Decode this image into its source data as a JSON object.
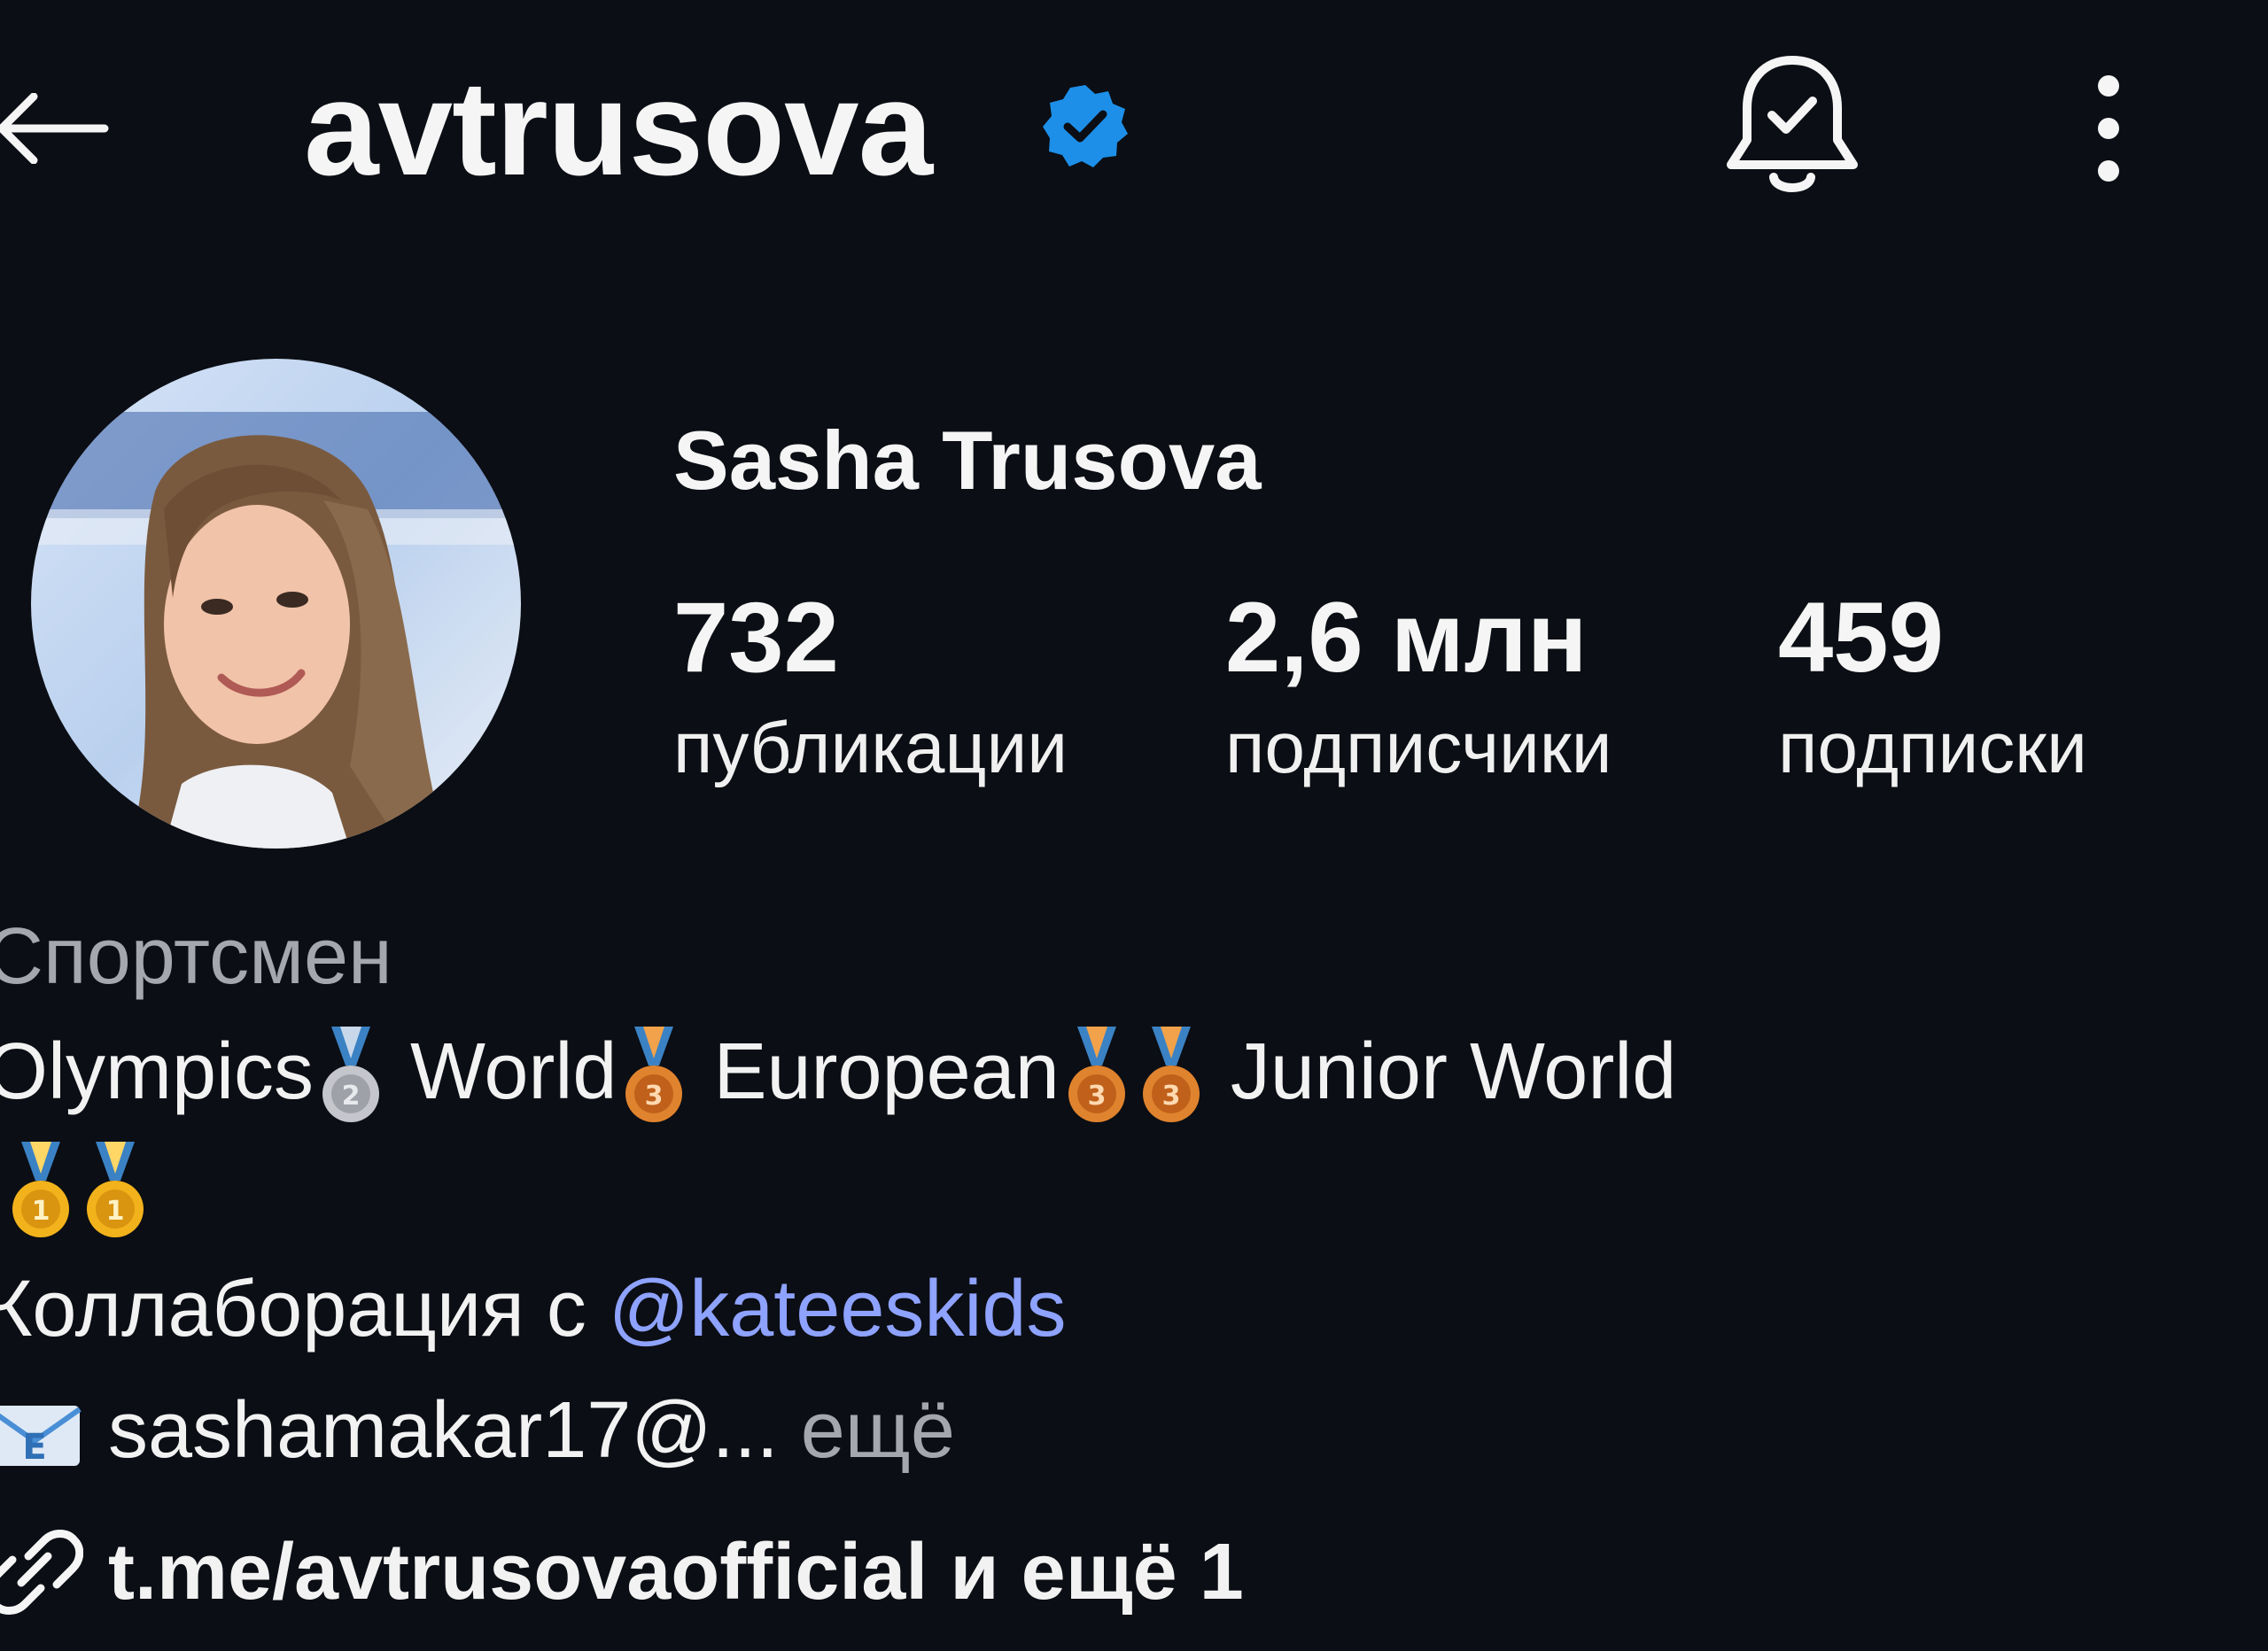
{
  "header": {
    "username": "avtrusova",
    "verified": true,
    "icons": [
      "back-arrow-icon",
      "verified-badge-icon",
      "bell-check-icon",
      "more-vertical-icon"
    ]
  },
  "profile": {
    "full_name": "Sasha Trusova",
    "stats": [
      {
        "value": "732",
        "label": "публикации"
      },
      {
        "value": "2,6 млн",
        "label": "подписчики"
      },
      {
        "value": "459",
        "label": "подписки"
      }
    ]
  },
  "bio": {
    "category": "Спортсмен",
    "achievements": [
      {
        "text": "Olympics",
        "medal": "silver"
      },
      {
        "text": "World",
        "medal": "bronze"
      },
      {
        "text": "European",
        "medal": "bronze"
      },
      {
        "text": "",
        "medal": "bronze"
      },
      {
        "text": "Junior World",
        "medal": ""
      }
    ],
    "junior_medals": [
      "gold",
      "gold"
    ],
    "collab_prefix": "Коллаборация с",
    "collab_mention": "@kateeskids",
    "email_text": "sashamakar17@...",
    "more_label": "ещё",
    "link_text": "t.me/avtrusovaofficial и ещё 1"
  },
  "colors": {
    "background": "#0b0e14",
    "verified_blue": "#1d8fe8",
    "mention": "#8ea2ff",
    "secondary_text": "#a4a7ad",
    "gold": "#f2b21b",
    "silver": "#c4c6cc",
    "bronze": "#e0832e",
    "ribbon": "#3b82c4"
  }
}
